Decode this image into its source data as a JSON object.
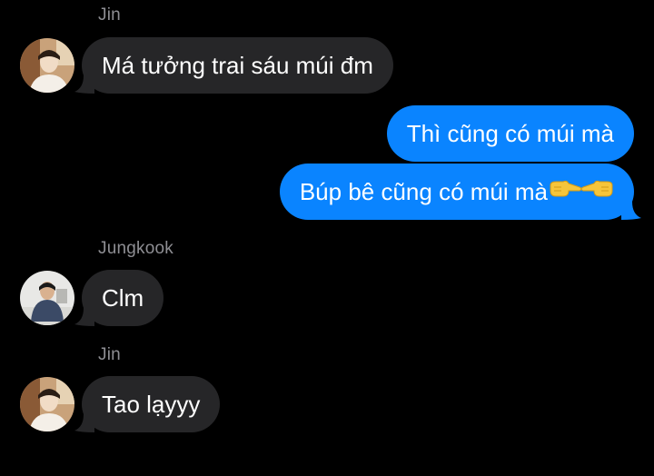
{
  "messages": [
    {
      "sender": "Jin",
      "direction": "incoming",
      "text": "Má tưởng trai sáu múi đm"
    },
    {
      "sender": "",
      "direction": "outgoing",
      "text": "Thì cũng có múi mà"
    },
    {
      "sender": "",
      "direction": "outgoing",
      "text": "Búp bê cũng có múi mà",
      "emoji": [
        "backhand-index-pointing-right",
        "backhand-index-pointing-left"
      ]
    },
    {
      "sender": "Jungkook",
      "direction": "incoming",
      "text": "Clm"
    },
    {
      "sender": "Jin",
      "direction": "incoming",
      "text": "Tao lạyyy"
    }
  ],
  "colors": {
    "background": "#000000",
    "incoming_bubble": "#262628",
    "outgoing_bubble": "#0a84ff",
    "sender_name": "#8e8e93",
    "text": "#ffffff"
  }
}
